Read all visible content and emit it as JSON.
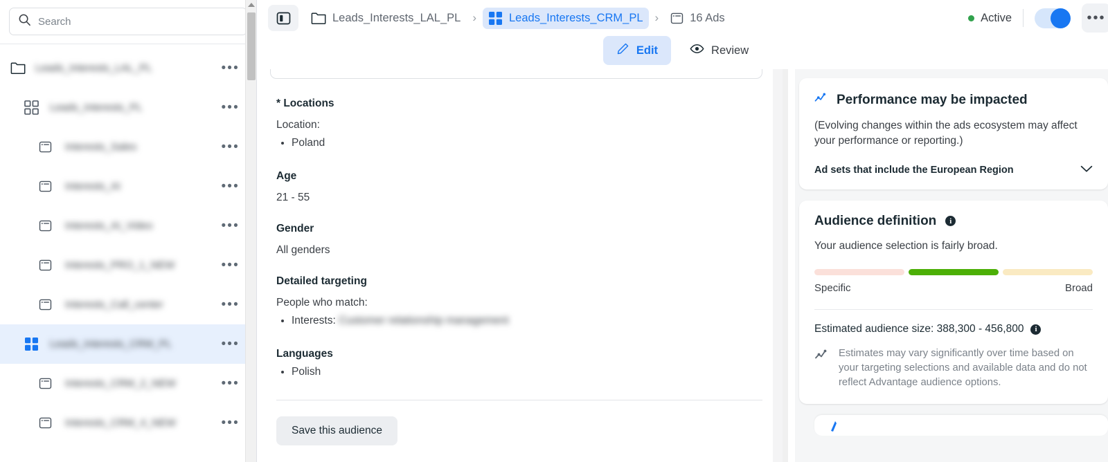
{
  "sidebar": {
    "search": {
      "placeholder": "Search",
      "value": "",
      "icon": "search-icon"
    },
    "items": [
      {
        "label": "Leads_Interests_LAL_PL",
        "icon": "folder-icon",
        "level": 0,
        "selected": false,
        "menu": "•••"
      },
      {
        "label": "Leads_Interests_PL",
        "icon": "grid-icon",
        "level": 1,
        "selected": false,
        "menu": "•••"
      },
      {
        "label": "Interests_Sales",
        "icon": "ad-icon",
        "level": 2,
        "selected": false,
        "menu": "•••"
      },
      {
        "label": "Interests_AI",
        "icon": "ad-icon",
        "level": 2,
        "selected": false,
        "menu": "•••"
      },
      {
        "label": "Interests_AI_Video",
        "icon": "ad-icon",
        "level": 2,
        "selected": false,
        "menu": "•••"
      },
      {
        "label": "Interests_PRO_1_NEW",
        "icon": "ad-icon",
        "level": 2,
        "selected": false,
        "menu": "•••"
      },
      {
        "label": "Interests_Call_center",
        "icon": "ad-icon",
        "level": 2,
        "selected": false,
        "menu": "•••"
      },
      {
        "label": "Leads_Interests_CRM_PL",
        "icon": "grid-icon",
        "level": 1,
        "selected": true,
        "menu": "•••"
      },
      {
        "label": "Interests_CRM_2_NEW",
        "icon": "ad-icon",
        "level": 2,
        "selected": false,
        "menu": "•••"
      },
      {
        "label": "Interests_CRM_4_NEW",
        "icon": "ad-icon",
        "level": 2,
        "selected": false,
        "menu": "•••"
      }
    ]
  },
  "topbar": {
    "panel_toggle_icon": "sidebar-panel-icon",
    "breadcrumbs": [
      {
        "label": "Leads_Interests_LAL_PL",
        "icon": "folder-icon",
        "active": false
      },
      {
        "label": "Leads_Interests_CRM_PL",
        "icon": "grid-icon",
        "active": true
      },
      {
        "label": "16 Ads",
        "icon": "ad-icon",
        "active": false
      }
    ],
    "separator": "›",
    "status_label": "Active",
    "status_color": "#31a24c",
    "toggle_on": true,
    "more_label": "•••"
  },
  "tabs": [
    {
      "label": "Edit",
      "icon": "pencil-icon",
      "active": true
    },
    {
      "label": "Review",
      "icon": "eye-icon",
      "active": false
    }
  ],
  "main": {
    "locations": {
      "title": "* Locations",
      "sub": "Location:",
      "values": [
        "Poland"
      ]
    },
    "age": {
      "title": "Age",
      "value": "21 - 55"
    },
    "gender": {
      "title": "Gender",
      "value": "All genders"
    },
    "detailed_targeting": {
      "title": "Detailed targeting",
      "sub": "People who match:",
      "item_label": "Interests:",
      "item_value": "Customer relationship management"
    },
    "languages": {
      "title": "Languages",
      "values": [
        "Polish"
      ]
    },
    "save_button": "Save this audience"
  },
  "right_panel": {
    "performance_card": {
      "icon": "trend-chart-icon",
      "title": "Performance may be impacted",
      "body": "(Evolving changes within the ads ecosystem may affect your performance or reporting.)",
      "collapse_label": "Ad sets that include the European Region",
      "chevron_icon": "chevron-down-icon"
    },
    "audience_card": {
      "title": "Audience definition",
      "info_icon": "info-icon",
      "subtitle": "Your audience selection is fairly broad.",
      "meter": {
        "segments": [
          {
            "color": "#fbe0da",
            "flex": 1
          },
          {
            "color": "#4caf06",
            "flex": 1
          },
          {
            "color": "#faeac2",
            "flex": 1
          }
        ],
        "left_label": "Specific",
        "right_label": "Broad",
        "active_index": 1
      },
      "estimate_label": "Estimated audience size: 388,300 - 456,800",
      "estimate_info_icon": "info-icon",
      "note_icon": "trend-chart-icon",
      "note": "Estimates may vary significantly over time based on your targeting selections and available data and do not reflect Advantage audience options."
    }
  }
}
